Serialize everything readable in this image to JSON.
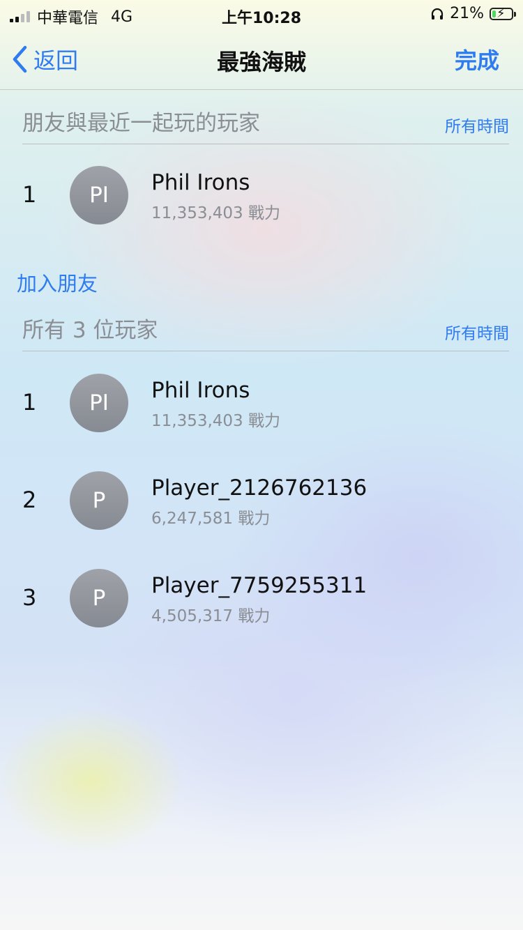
{
  "status_bar": {
    "carrier": "中華電信",
    "network": "4G",
    "time": "上午10:28",
    "battery": "21%",
    "battery_level": 0.21
  },
  "nav": {
    "back_label": "返回",
    "title": "最強海賊",
    "done_label": "完成"
  },
  "friends_section": {
    "title": "朋友與最近一起玩的玩家",
    "filter": "所有時間",
    "players": [
      {
        "rank": "1",
        "initials": "PI",
        "name": "Phil Irons",
        "score": "11,353,403 戰力"
      }
    ]
  },
  "add_friend_label": "加入朋友",
  "all_section": {
    "title": "所有 3 位玩家",
    "filter": "所有時間",
    "players": [
      {
        "rank": "1",
        "initials": "PI",
        "name": "Phil Irons",
        "score": "11,353,403 戰力"
      },
      {
        "rank": "2",
        "initials": "P",
        "name": "Player_2126762136",
        "score": "6,247,581 戰力"
      },
      {
        "rank": "3",
        "initials": "P",
        "name": "Player_7759255311",
        "score": "4,505,317 戰力"
      }
    ]
  },
  "colors": {
    "accent": "#2f7cf0",
    "secondary_text": "#8a8e94",
    "avatar": "#8f939a"
  }
}
